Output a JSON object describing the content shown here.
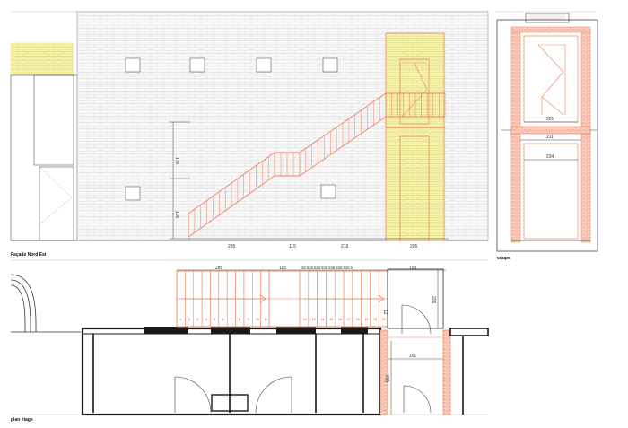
{
  "labels": {
    "facade": "Façade Nord Est",
    "coupe": "coupe",
    "plan": "plan étage"
  },
  "facade_dims": {
    "h1": "170",
    "h2": "100",
    "b1": "285",
    "b2": "115",
    "b3": "219",
    "b4": "205"
  },
  "coupe_dims": {
    "d1": "201",
    "d2": "211",
    "d3": "234"
  },
  "plan_dims": {
    "top1": "285",
    "top2": "115",
    "top3": "28.528.528.528.528.528.528.5",
    "top4": "193",
    "side1": "205",
    "side2": "201",
    "side3": "205",
    "s12": "12"
  },
  "step_numbers": [
    "1",
    "2",
    "3",
    "4",
    "5",
    "6",
    "7",
    "8",
    "9",
    "10",
    "11",
    "12",
    "13",
    "14",
    "15",
    "16",
    "17",
    "18",
    "19",
    "20",
    "21"
  ],
  "colors": {
    "stair": "#e9835f",
    "brick": "#f3f0a6",
    "line": "#444444",
    "wall": "#1a1a1a"
  }
}
